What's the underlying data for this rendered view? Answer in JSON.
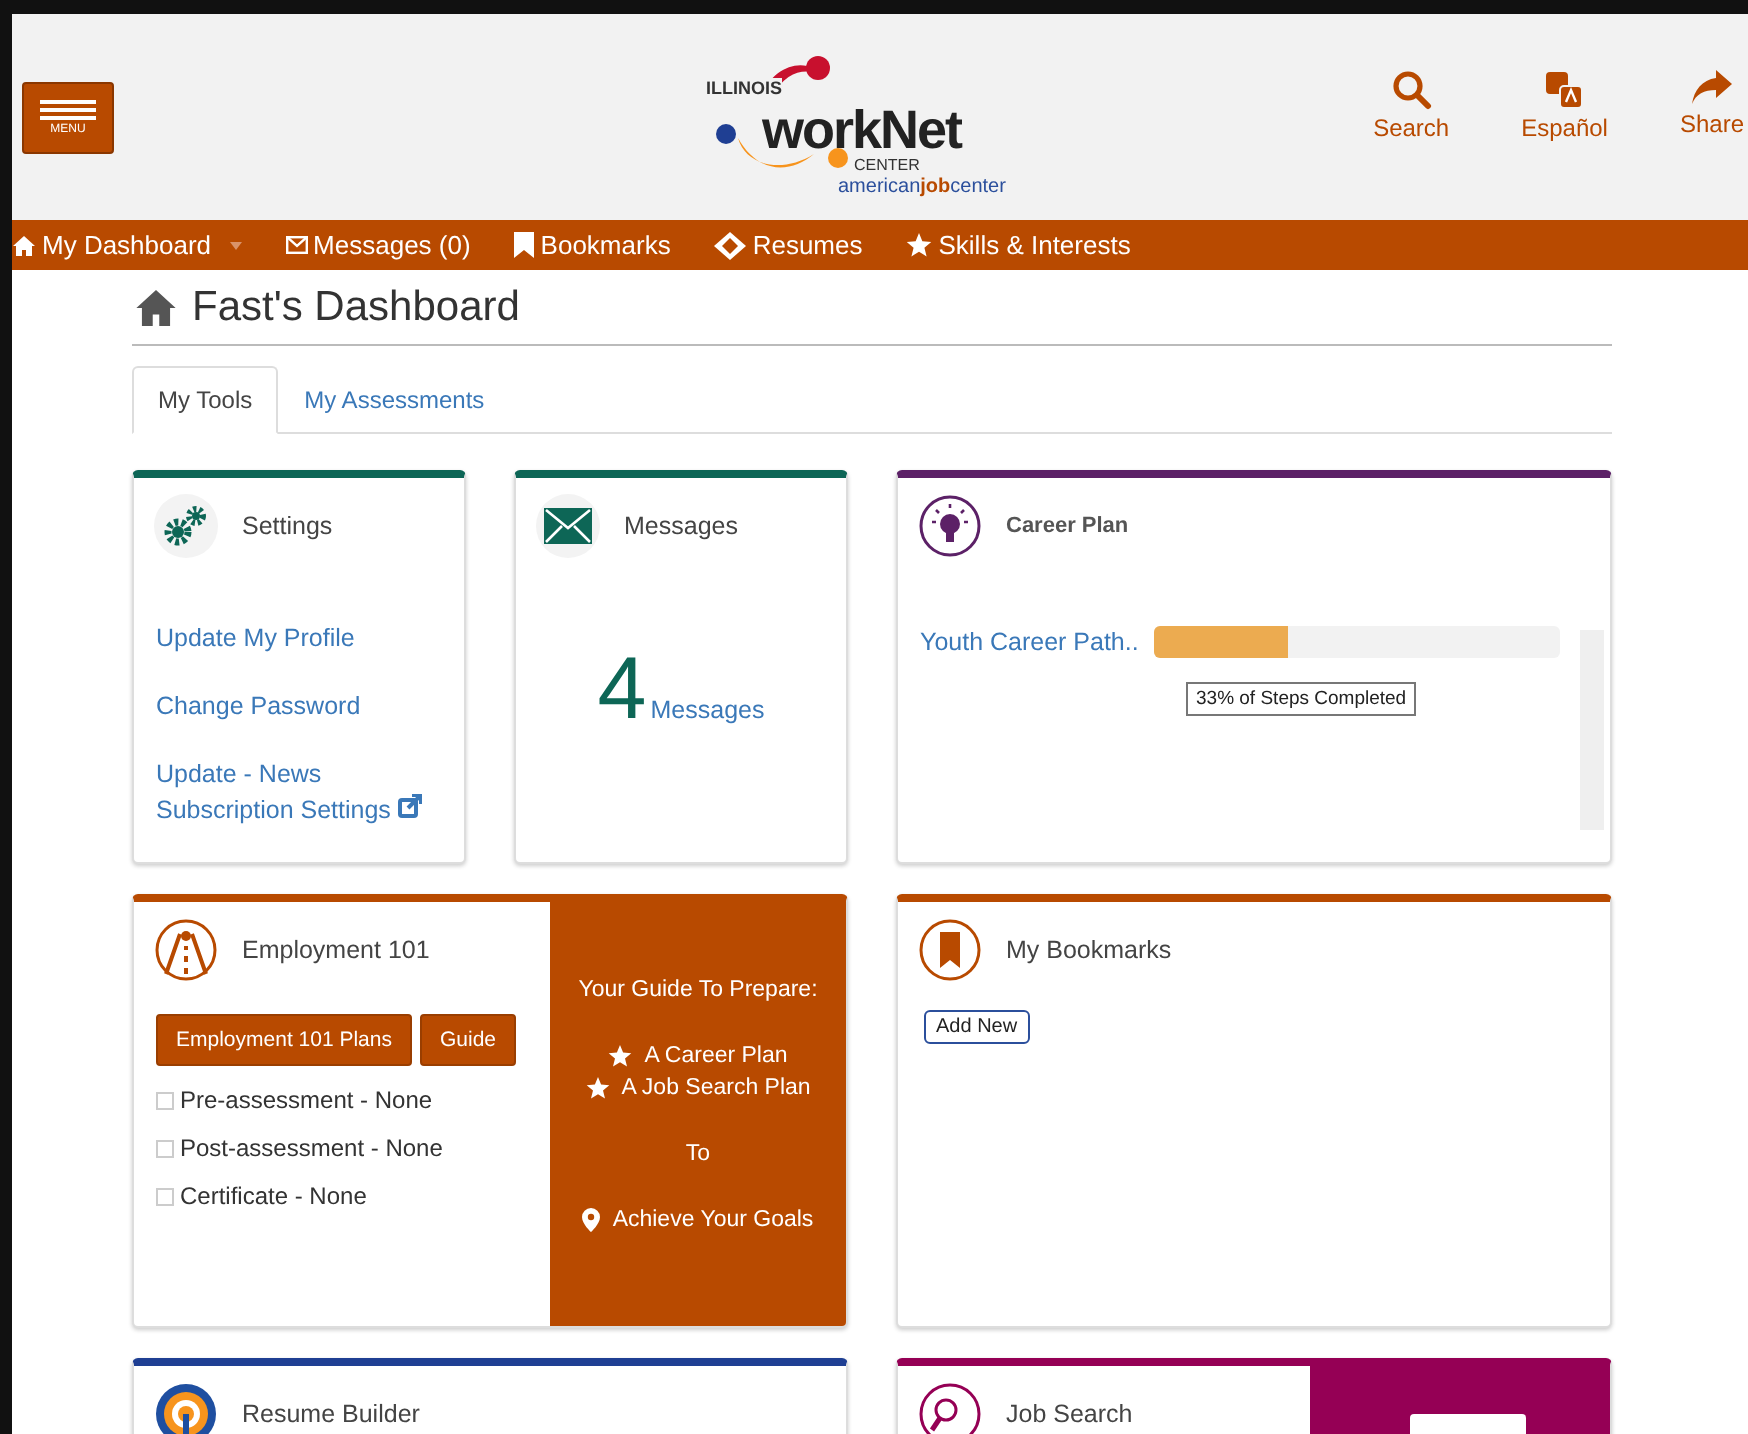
{
  "header": {
    "menu_button": {
      "label": "MENU"
    },
    "logo": {
      "top": "ILLINOIS",
      "main": "workNet",
      "sub": "CENTER",
      "tagline": "american**job**center"
    },
    "actions": [
      {
        "label": "Search"
      },
      {
        "label": "Español"
      },
      {
        "label": "Share"
      }
    ]
  },
  "nav": [
    {
      "label": "My Dashboard",
      "dropdown": true
    },
    {
      "label": "Messages (0)",
      "dropdown": false
    },
    {
      "label": "Bookmarks",
      "dropdown": false
    },
    {
      "label": "Resumes",
      "dropdown": false
    },
    {
      "label": "Skills & Interests",
      "dropdown": false
    }
  ],
  "page_title": "Fast's Dashboard",
  "tabs": [
    {
      "label": "My Tools",
      "selected": true
    },
    {
      "label": "My Assessments",
      "selected": false
    }
  ],
  "settings_card": {
    "title": "Settings",
    "links": [
      {
        "label": "Update My Profile",
        "external": false
      },
      {
        "label": "Change Password",
        "external": false
      },
      {
        "label": "Update - News Subscription Settings",
        "external": true
      }
    ]
  },
  "messages_card": {
    "title": "Messages",
    "count": "4",
    "count_label": "Messages"
  },
  "career_plan_card": {
    "title": "Career Plan",
    "plans": [
      {
        "name": "Youth Career Path..",
        "level": 0.33,
        "status": "33% of Steps Completed"
      }
    ]
  },
  "employment_card": {
    "title": "Employment 101",
    "buttons": [
      "Employment 101 Plans",
      "Guide"
    ],
    "items": [
      {
        "label": "Pre-assessment - None",
        "checked": false
      },
      {
        "label": "Post-assessment - None",
        "checked": false
      },
      {
        "label": "Certificate - None",
        "checked": false
      }
    ],
    "guide": [
      {
        "kind": "heading",
        "text": "Your Guide To Prepare:"
      },
      {
        "kind": "star",
        "text": "A Career Plan"
      },
      {
        "kind": "star",
        "text": "A Job Search Plan"
      },
      {
        "kind": "plain",
        "text": "To"
      },
      {
        "kind": "pin",
        "text": "Achieve Your Goals"
      }
    ]
  },
  "bookmarks_card": {
    "title": "My Bookmarks",
    "button": "Add New"
  },
  "resume_card": {
    "title": "Resume Builder"
  },
  "job_search_card": {
    "title": "Job Search"
  }
}
